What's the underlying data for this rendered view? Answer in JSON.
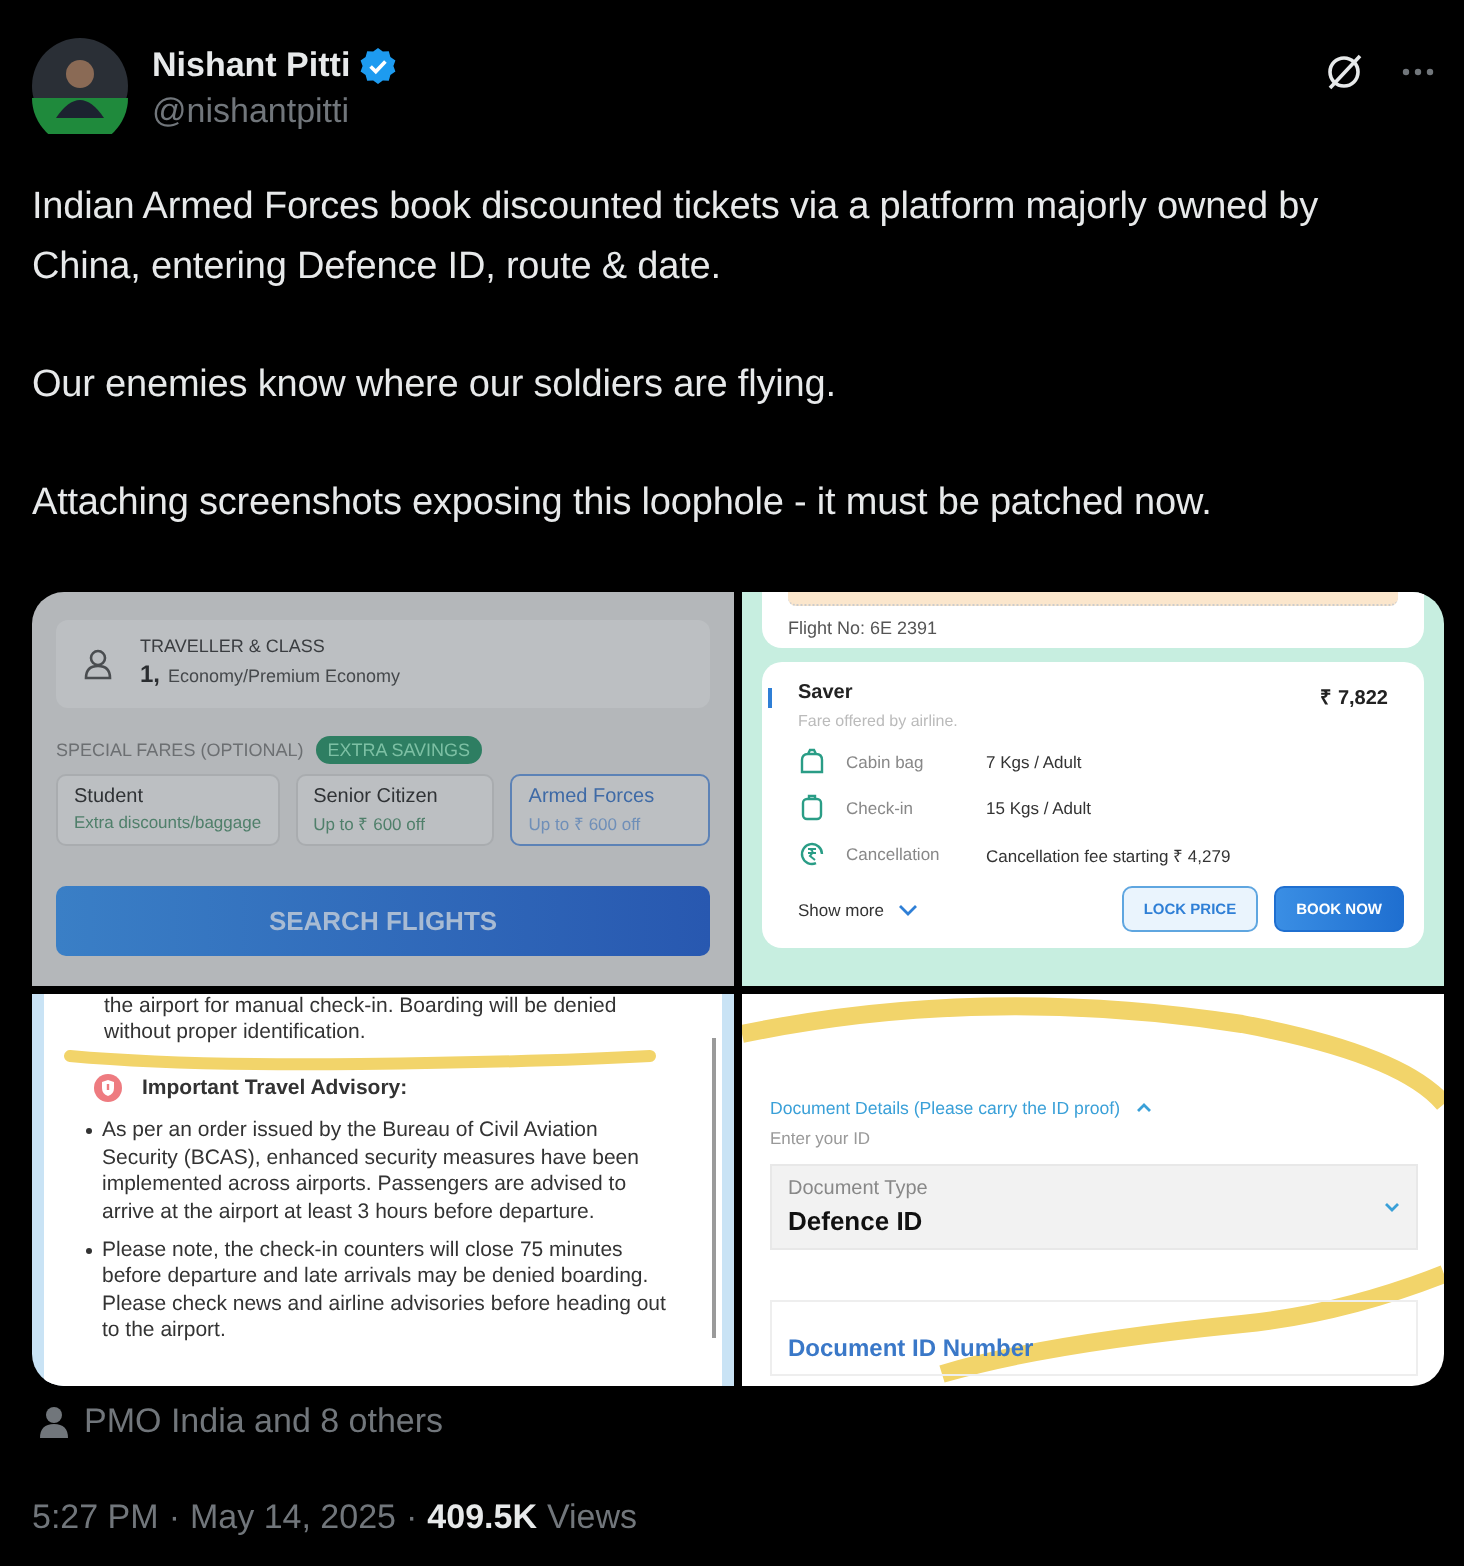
{
  "author": {
    "name": "Nishant Pitti",
    "handle": "@nishantpitti",
    "verified": true
  },
  "paragraphs": [
    "Indian Armed Forces book discounted tickets via a platform majorly owned by China, entering Defence ID, route & date.",
    "Our enemies know where our soldiers are flying.",
    "Attaching screenshots exposing this loophole - it must be patched now."
  ],
  "media": [
    {
      "kind": "fares",
      "traveller_label": "TRAVELLER & CLASS",
      "traveller_count": "1,",
      "traveller_class": "Economy/Premium Economy",
      "special_label": "SPECIAL FARES (OPTIONAL)",
      "badge": "EXTRA SAVINGS",
      "options": [
        {
          "title": "Student",
          "note": "Extra discounts/baggage",
          "selected": false
        },
        {
          "title": "Senior Citizen",
          "note": "Up to ₹ 600 off",
          "selected": false
        },
        {
          "title": "Armed Forces",
          "note": "Up to ₹ 600 off",
          "selected": true
        }
      ],
      "button": "SEARCH FLIGHTS"
    },
    {
      "kind": "flight",
      "flight_no": "Flight No: 6E 2391",
      "fare_name": "Saver",
      "price": "₹ 7,822",
      "fare_note": "Fare offered by airline.",
      "rows": [
        {
          "kind": "cabin",
          "label": "Cabin bag",
          "value": "7 Kgs / Adult"
        },
        {
          "kind": "checkin",
          "label": "Check-in",
          "value": "15 Kgs / Adult"
        },
        {
          "kind": "refund",
          "label": "Cancellation",
          "value": "Cancellation fee starting ₹ 4,279"
        }
      ],
      "show_more": "Show more",
      "buttons": [
        "LOCK PRICE",
        "BOOK NOW"
      ]
    },
    {
      "kind": "advisory",
      "intro": "the airport for manual check-in. Boarding will be denied without proper identification.",
      "heading": "Important Travel Advisory:",
      "bullets": [
        "As per an order issued by the Bureau of Civil Aviation Security (BCAS), enhanced security measures have been implemented across airports. Passengers are advised to arrive at the airport at least 3 hours before departure.",
        "Please note, the check-in counters will close 75 minutes before departure and late arrivals may be denied boarding. Please check news and airline advisories before heading out to the airport."
      ]
    },
    {
      "kind": "document",
      "section": "Document Details (Please carry the ID proof)",
      "hint": "Enter your ID",
      "type_label": "Document Type",
      "type_value": "Defence ID",
      "number_label": "Document ID Number"
    }
  ],
  "tagged": "PMO India and 8 others",
  "time": "5:27 PM",
  "date": "May 14, 2025",
  "separator": "·",
  "views_count": "409.5K",
  "views_label": "Views"
}
